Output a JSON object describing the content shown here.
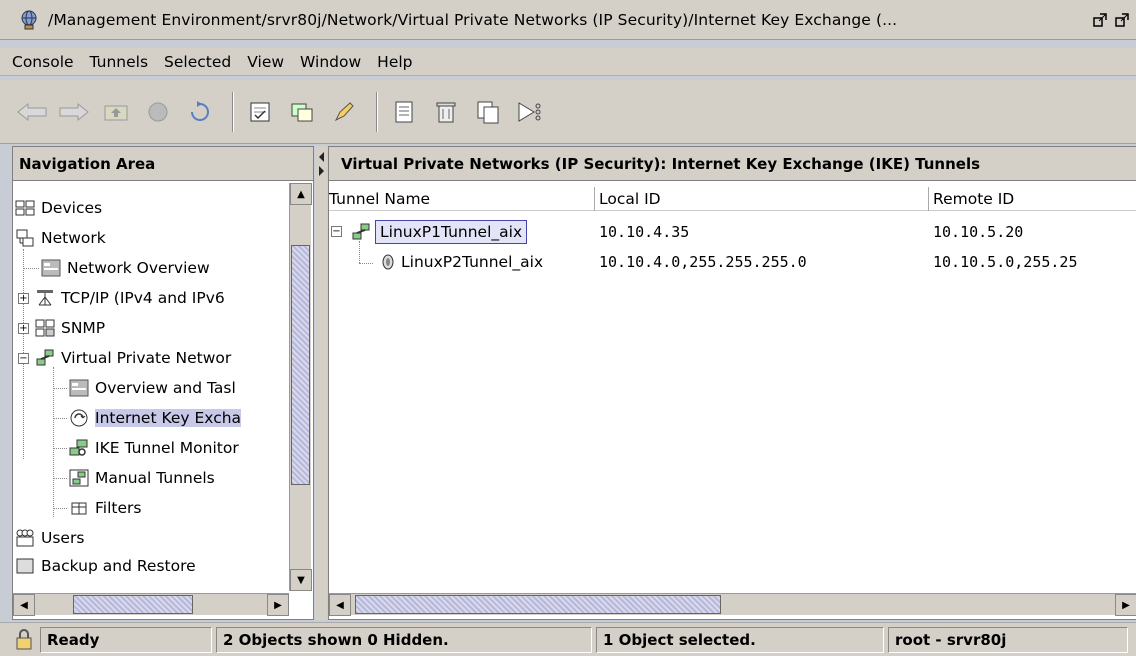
{
  "window": {
    "title": "/Management Environment/srvr80j/Network/Virtual Private Networks (IP Security)/Internet Key Exchange (...",
    "minimize_icon": "restore-icon",
    "maximize_icon": "restore-icon"
  },
  "menu": {
    "items": [
      "Console",
      "Tunnels",
      "Selected",
      "View",
      "Window",
      "Help"
    ]
  },
  "toolbar": {
    "icons": [
      "back-arrow-icon",
      "forward-arrow-icon",
      "up-folder-icon",
      "stop-icon",
      "refresh-icon",
      "properties-icon",
      "copy-object-icon",
      "edit-icon",
      "document-icon",
      "delete-icon",
      "copy-icon",
      "run-icon"
    ]
  },
  "nav": {
    "header": "Navigation Area",
    "items": [
      {
        "label": "Devices",
        "icon": "devices-icon"
      },
      {
        "label": "Network",
        "icon": "network-icon"
      },
      {
        "label": "Network Overview",
        "icon": "overview-icon"
      },
      {
        "label": "TCP/IP (IPv4 and IPv6",
        "icon": "tcpip-icon"
      },
      {
        "label": "SNMP",
        "icon": "snmp-icon"
      },
      {
        "label": "Virtual Private Networ",
        "icon": "vpn-icon"
      },
      {
        "label": "Overview and Tasl",
        "icon": "overview-icon"
      },
      {
        "label": "Internet Key Excha",
        "icon": "ike-icon"
      },
      {
        "label": "IKE Tunnel Monitor",
        "icon": "monitor-icon"
      },
      {
        "label": "Manual Tunnels",
        "icon": "manual-tunnel-icon"
      },
      {
        "label": "Filters",
        "icon": "filters-icon"
      },
      {
        "label": "Users",
        "icon": "users-icon"
      },
      {
        "label": "Backup and Restore",
        "icon": "backup-icon"
      }
    ]
  },
  "content": {
    "header": "Virtual Private Networks (IP Security): Internet Key Exchange (IKE) Tunnels",
    "columns": [
      "Tunnel Name",
      "Local ID",
      "Remote ID"
    ],
    "rows": [
      {
        "name": "LinuxP1Tunnel_aix",
        "local_id": "10.10.4.35",
        "remote_id": "10.10.5.20"
      },
      {
        "name": "LinuxP2Tunnel_aix",
        "local_id": "10.10.4.0,255.255.255.0",
        "remote_id": "10.10.5.0,255.25"
      }
    ]
  },
  "status": {
    "state": "Ready",
    "objects": "2 Objects shown 0 Hidden.",
    "selected": "1 Object selected.",
    "user": "root - srvr80j"
  },
  "colors": {
    "chrome": "#d4d0c8",
    "selection": "#c8c8e8",
    "scroll_thumb": "#b7b7d8"
  }
}
